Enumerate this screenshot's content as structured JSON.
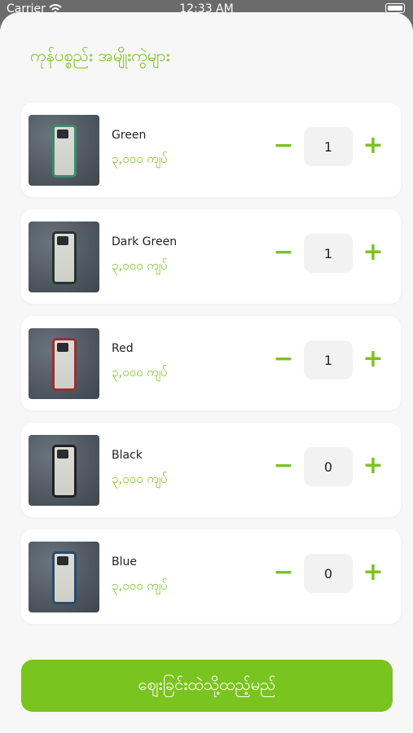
{
  "status_bar": {
    "carrier": "Carrier",
    "time": "12:33 AM"
  },
  "sheet": {
    "title": "ကုန်ပစ္စည်း အမျိုးကွဲများ"
  },
  "items": [
    {
      "name": "Green",
      "price": "၃,၀၀၀ ကျပ်",
      "qty": "1",
      "case_color": "#3f8a6e"
    },
    {
      "name": "Dark Green",
      "price": "၃,၀၀၀ ကျပ်",
      "qty": "1",
      "case_color": "#26342f"
    },
    {
      "name": "Red",
      "price": "၃,၀၀၀ ကျပ်",
      "qty": "1",
      "case_color": "#9b2f33"
    },
    {
      "name": "Black",
      "price": "၃,၀၀၀ ကျပ်",
      "qty": "0",
      "case_color": "#1f2124"
    },
    {
      "name": "Blue",
      "price": "၃,၀၀၀ ကျပ်",
      "qty": "0",
      "case_color": "#2c4a6b"
    }
  ],
  "buttons": {
    "minus": "−",
    "plus": "+",
    "add_to_cart": "ဈေးခြင်းထဲသို့ထည့်မည်"
  },
  "colors": {
    "accent": "#7ac41f"
  }
}
